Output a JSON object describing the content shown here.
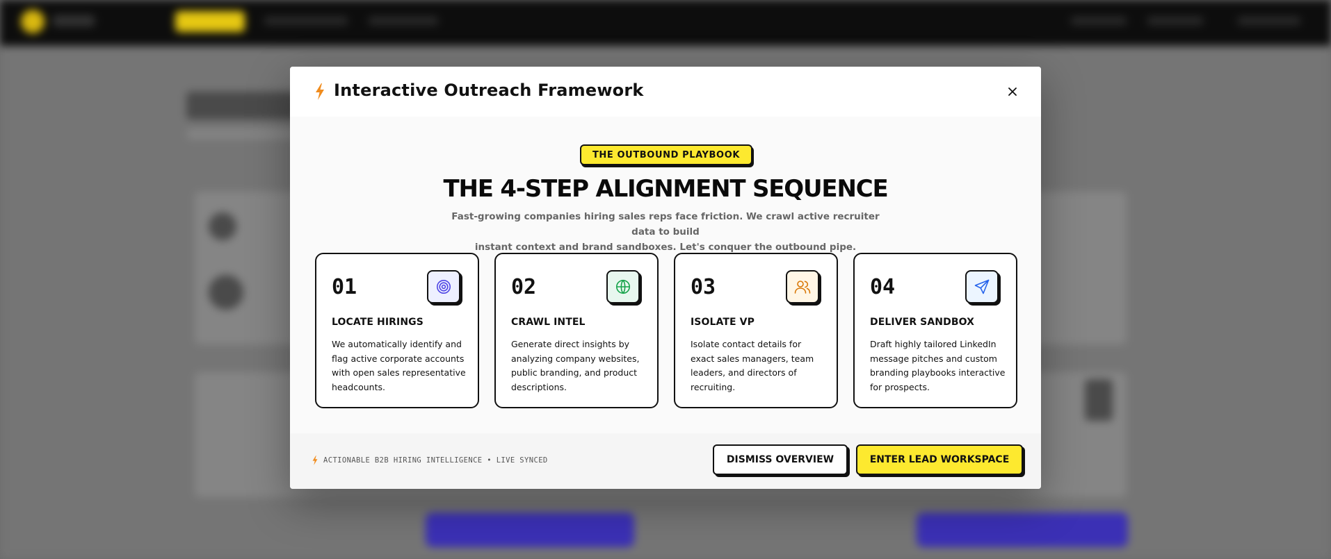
{
  "modal": {
    "title": "Interactive Outreach Framework",
    "badge": "THE OUTBOUND PLAYBOOK",
    "headline": "THE 4-STEP ALIGNMENT SEQUENCE",
    "subtext_line1": "Fast-growing companies hiring sales reps face friction. We crawl active recruiter data to build",
    "subtext_line2": "instant context and brand sandboxes. Let's conquer the outbound pipe.",
    "close_icon": "close-icon"
  },
  "steps": [
    {
      "number": "01",
      "title": "LOCATE HIRINGS",
      "description": "We automatically identify and flag active corporate accounts with open sales representative headcounts.",
      "icon": "target-icon",
      "icon_bg": "#eef0ff",
      "icon_color": "#4f46e5"
    },
    {
      "number": "02",
      "title": "CRAWL INTEL",
      "description": "Generate direct insights by analyzing company websites, public branding, and product descriptions.",
      "icon": "globe-icon",
      "icon_bg": "#e8f7ef",
      "icon_color": "#16a34a"
    },
    {
      "number": "03",
      "title": "ISOLATE VP",
      "description": "Isolate contact details for exact sales managers, team leaders, and directors of recruiting.",
      "icon": "users-icon",
      "icon_bg": "#fff6e6",
      "icon_color": "#d97706"
    },
    {
      "number": "04",
      "title": "DELIVER SANDBOX",
      "description": "Draft highly tailored LinkedIn message pitches and custom branding playbooks interactive for prospects.",
      "icon": "send-icon",
      "icon_bg": "#ecf5ff",
      "icon_color": "#2563eb"
    }
  ],
  "footer": {
    "status_text": "ACTIONABLE B2B HIRING INTELLIGENCE • LIVE SYNCED",
    "dismiss_label": "DISMISS OVERVIEW",
    "enter_label": "ENTER LEAD WORKSPACE"
  },
  "colors": {
    "accent_yellow": "#fde92f",
    "bolt_orange": "#f08c1e",
    "overlay": "#6b6b6b"
  }
}
